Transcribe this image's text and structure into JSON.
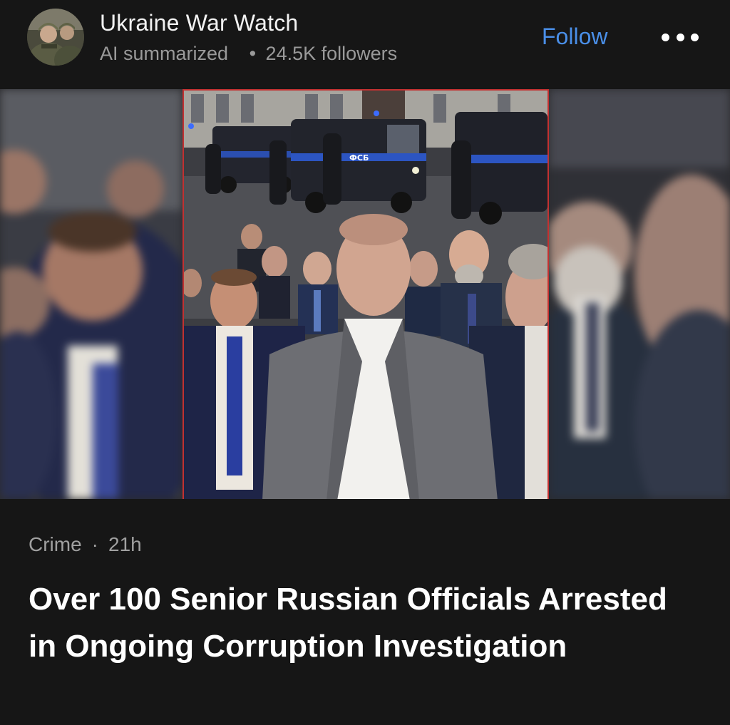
{
  "source": {
    "name": "Ukraine War Watch",
    "summary_label": "AI summarized",
    "followers": "24.5K followers",
    "separator": "•"
  },
  "actions": {
    "follow_label": "Follow",
    "more_icon": "more-horizontal-icon"
  },
  "article": {
    "category": "Crime",
    "separator": "·",
    "age": "21h",
    "headline": "Over 100 Senior Russian Officials Arrested in Ongoing Corruption Investigation"
  },
  "hero": {
    "van_marking": "ФСБ",
    "frame_color": "#c23131"
  },
  "colors": {
    "background": "#161616",
    "accent": "#4a8fe8",
    "muted_text": "#9a9a9a"
  }
}
